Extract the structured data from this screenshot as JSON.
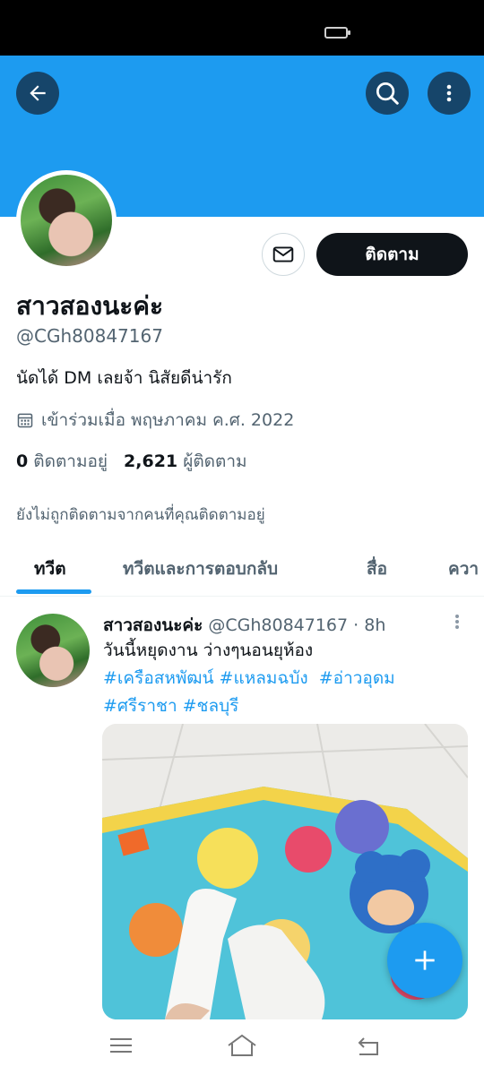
{
  "profile": {
    "display_name": "สาวสองนะค่ะ",
    "handle": "@CGh80847167",
    "bio": "นัดได้ DM เลยจ้า นิสัยดีน่ารัก",
    "joined": "เข้าร่วมเมื่อ พฤษภาคม ค.ศ. 2022",
    "following_count": "0",
    "following_label": "ติดตามอยู่",
    "followers_count": "2,621",
    "followers_label": "ผู้ติดตาม",
    "not_followed_note": "ยังไม่ถูกติดตามจากคนที่คุณติดตามอยู่",
    "follow_button": "ติดตาม"
  },
  "tabs": [
    {
      "label": "ทวีต",
      "active": true
    },
    {
      "label": "ทวีตและการตอบกลับ",
      "active": false
    },
    {
      "label": "สื่อ",
      "active": false
    },
    {
      "label": "ควา",
      "active": false
    }
  ],
  "tweet": {
    "name": "สาวสองนะค่ะ",
    "handle": "@CGh80847167",
    "separator": "·",
    "time": "8h",
    "text": "วันนี้หยุดงาน ว่างๆนอนยุห้อง",
    "hashtags": [
      "#เครือสหพัฒน์",
      "#แหลมฉบัง",
      "#อ่าวอุดม",
      "#ศรีราชา",
      "#ชลบุรี"
    ]
  },
  "colors": {
    "accent": "#1d9bf0",
    "banner": "#1d9bf0",
    "follow_bg": "#0f1419",
    "secondary_text": "#536471"
  },
  "icons": {
    "back": "arrow-left",
    "search": "magnifier",
    "more": "vertical-dots",
    "message": "envelope",
    "calendar": "calendar",
    "compose": "plus",
    "nav_menu": "three-lines",
    "nav_home": "house",
    "nav_back": "return-arrow"
  }
}
